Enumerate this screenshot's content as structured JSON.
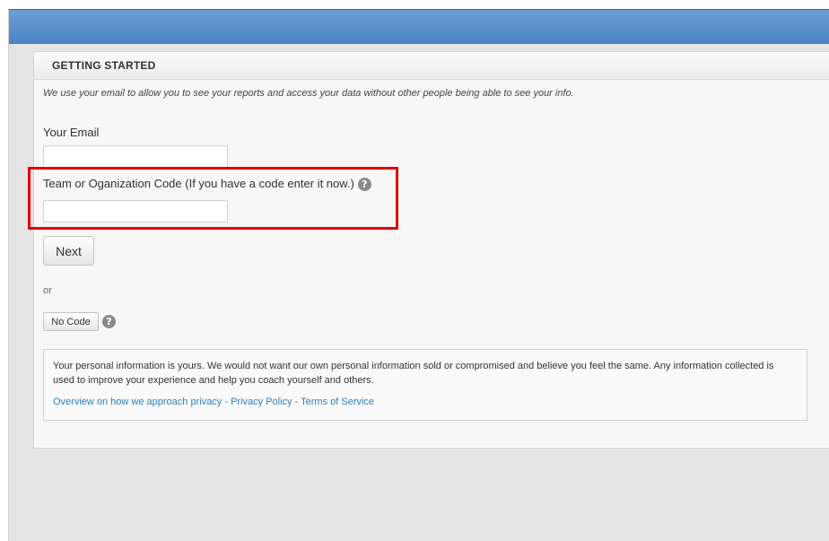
{
  "panel": {
    "title": "GETTING STARTED",
    "intro": "We use your email to allow you to see your reports and access your data without other people being able to see your info."
  },
  "form": {
    "email_label": "Your Email",
    "email_value": "",
    "code_label": "Team or Oganization Code (If you have a code enter it now.)",
    "code_value": "",
    "next_button": "Next",
    "or_text": "or",
    "no_code_button": "No Code",
    "help_glyph": "?"
  },
  "privacy": {
    "text": "Your personal information is yours. We would not want our own personal information sold or compromised and believe you feel the same. Any information collected is used to improve your experience and help you coach yourself and others.",
    "links": [
      "Overview on how we approach privacy",
      "Privacy Policy",
      "Terms of Service"
    ],
    "separator": " - "
  },
  "icons": {
    "help": "question-circle-icon"
  },
  "colors": {
    "top_bar": "#4a84c3",
    "highlight": "#e00000",
    "link": "#2a7fc0"
  }
}
